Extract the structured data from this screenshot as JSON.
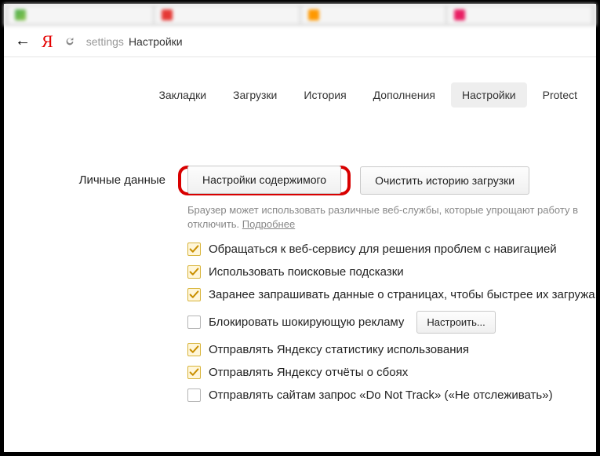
{
  "tabs": [
    {
      "label": ""
    },
    {
      "label": ""
    },
    {
      "label": ""
    },
    {
      "label": ""
    }
  ],
  "addressbar": {
    "path": "settings",
    "title": "Настройки"
  },
  "nav": {
    "items": [
      {
        "label": "Закладки"
      },
      {
        "label": "Загрузки"
      },
      {
        "label": "История"
      },
      {
        "label": "Дополнения"
      },
      {
        "label": "Настройки"
      },
      {
        "label": "Protect"
      }
    ],
    "active_index": 4
  },
  "section": {
    "title": "Личные данные",
    "btn_content": "Настройки содержимого",
    "btn_clear": "Очистить историю загрузки",
    "desc_prefix": "Браузер может использовать различные веб-службы, которые упрощают работу в ",
    "desc_suffix": "отключить. ",
    "desc_link": "Подробнее",
    "options": [
      {
        "checked": true,
        "label": "Обращаться к веб-сервису для решения проблем с навигацией"
      },
      {
        "checked": true,
        "label": "Использовать поисковые подсказки"
      },
      {
        "checked": true,
        "label": "Заранее запрашивать данные о страницах, чтобы быстрее их загружа"
      },
      {
        "checked": false,
        "label": "Блокировать шокирующую рекламу",
        "button": "Настроить..."
      },
      {
        "checked": true,
        "label": "Отправлять Яндексу статистику использования"
      },
      {
        "checked": true,
        "label": "Отправлять Яндексу отчёты о сбоях"
      },
      {
        "checked": false,
        "label": "Отправлять сайтам запрос «Do Not Track» («Не отслеживать»)"
      }
    ]
  }
}
